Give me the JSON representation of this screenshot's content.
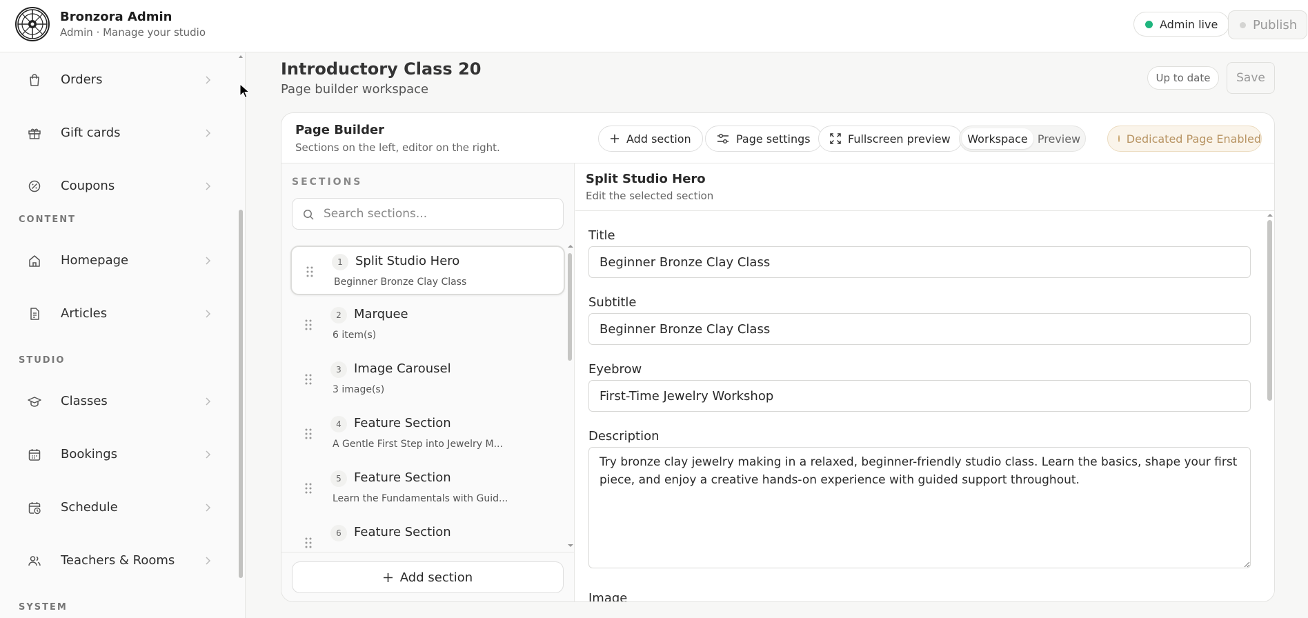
{
  "header": {
    "brand_title": "Bronzora Admin",
    "brand_subtitle": "Admin · Manage your studio",
    "admin_status": "Admin live",
    "admin_status_color": "#1fb57e",
    "publish_label": "Publish"
  },
  "sidebar": {
    "items_top": [
      {
        "label": "Orders",
        "icon": "shopping-bag-icon"
      },
      {
        "label": "Gift cards",
        "icon": "gift-icon"
      },
      {
        "label": "Coupons",
        "icon": "coupon-icon"
      }
    ],
    "group_content": "CONTENT",
    "items_content": [
      {
        "label": "Homepage",
        "icon": "home-icon"
      },
      {
        "label": "Articles",
        "icon": "document-icon"
      }
    ],
    "group_studio": "STUDIO",
    "items_studio": [
      {
        "label": "Classes",
        "icon": "graduation-cap-icon"
      },
      {
        "label": "Bookings",
        "icon": "calendar-icon"
      },
      {
        "label": "Schedule",
        "icon": "calendar-clock-icon"
      },
      {
        "label": "Teachers & Rooms",
        "icon": "users-icon"
      }
    ],
    "group_system": "SYSTEM"
  },
  "main": {
    "title": "Introductory Class 20",
    "subtitle": "Page builder workspace",
    "status_label": "Up to date",
    "save_label": "Save"
  },
  "builder": {
    "title": "Page Builder",
    "subtitle": "Sections on the left, editor on the right.",
    "add_section_label": "Add section",
    "page_settings_label": "Page settings",
    "fullscreen_label": "Fullscreen preview",
    "view_modes": [
      "Workspace",
      "Preview"
    ],
    "active_view": "Workspace",
    "dedicated_label": "Dedicated Page Enabled",
    "dedicated_color": "#c9a46c"
  },
  "sections": {
    "heading": "SECTIONS",
    "search_placeholder": "Search sections...",
    "add_label": "Add section",
    "items": [
      {
        "num": "1",
        "name": "Split Studio Hero",
        "meta": "Beginner Bronze Clay Class",
        "active": true
      },
      {
        "num": "2",
        "name": "Marquee",
        "meta": "6 item(s)"
      },
      {
        "num": "3",
        "name": "Image Carousel",
        "meta": "3 image(s)"
      },
      {
        "num": "4",
        "name": "Feature Section",
        "meta": "A Gentle First Step into Jewelry M..."
      },
      {
        "num": "5",
        "name": "Feature Section",
        "meta": "Learn the Fundamentals with Guid..."
      },
      {
        "num": "6",
        "name": "Feature Section",
        "meta": ""
      }
    ]
  },
  "editor": {
    "title": "Split Studio Hero",
    "subtitle": "Edit the selected section",
    "fields": {
      "title_label": "Title",
      "title_value": "Beginner Bronze Clay Class",
      "subtitle_label": "Subtitle",
      "subtitle_value": "Beginner Bronze Clay Class",
      "eyebrow_label": "Eyebrow",
      "eyebrow_value": "First-Time Jewelry Workshop",
      "description_label": "Description",
      "description_value": "Try bronze clay jewelry making in a relaxed, beginner-friendly studio class. Learn the basics, shape your first piece, and enjoy a creative hands-on experience with guided support throughout.",
      "image_label": "Image"
    }
  }
}
